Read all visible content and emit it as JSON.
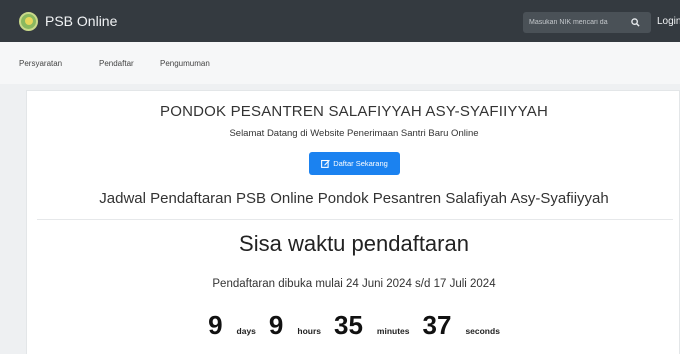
{
  "navbar": {
    "brand": "PSB Online",
    "search_placeholder": "Masukan NIK mencari da",
    "login_label": "Login"
  },
  "subnav": {
    "items": [
      "Persyaratan",
      "Pendaftar",
      "Pengumuman"
    ]
  },
  "main": {
    "title": "PONDOK PESANTREN SALAFIYYAH ASY-SYAFIIYYAH",
    "subtitle": "Selamat Datang di Website Penerimaan Santri Baru Online",
    "register_button": "Daftar Sekarang",
    "schedule_heading": "Jadwal Pendaftaran PSB Online Pondok Pesantren Salafiyah Asy-Syafiiyyah",
    "countdown_title": "Sisa waktu pendaftaran",
    "period_text": "Pendaftaran dibuka mulai 24 Juni 2024 s/d 17 Juli 2024"
  },
  "countdown": {
    "days": "9",
    "days_label": "days",
    "hours": "9",
    "hours_label": "hours",
    "minutes": "35",
    "minutes_label": "minutes",
    "seconds": "37",
    "seconds_label": "seconds"
  },
  "colors": {
    "navbar_bg": "#343a40",
    "primary_button": "#1b82f0"
  },
  "icons": {
    "brand": "mosque-logo-icon",
    "search": "search-icon",
    "register": "edit-icon"
  }
}
